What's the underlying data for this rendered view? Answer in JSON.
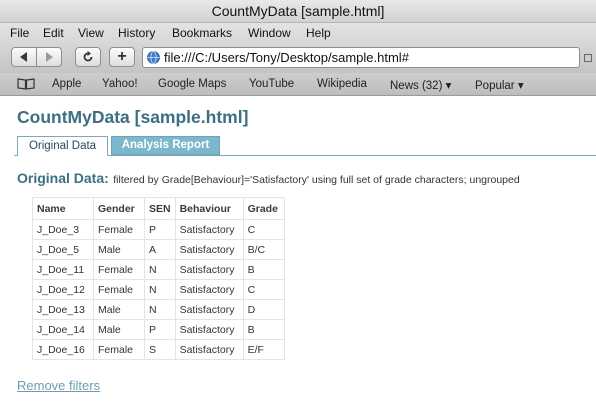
{
  "window": {
    "title": "CountMyData [sample.html]"
  },
  "menu": [
    "File",
    "Edit",
    "View",
    "History",
    "Bookmarks",
    "Window",
    "Help"
  ],
  "address": {
    "url": "file:///C:/Users/Tony/Desktop/sample.html#"
  },
  "toolbar": {
    "add_label": "+"
  },
  "bookmarks": [
    "Apple",
    "Yahoo!",
    "Google Maps",
    "YouTube",
    "Wikipedia",
    "News (32) ▾",
    "Popular ▾"
  ],
  "page": {
    "title": "CountMyData [sample.html]",
    "tabs": [
      "Original Data",
      "Analysis Report"
    ],
    "filter_label": "Original Data:",
    "filter_desc": "filtered by Grade[Behaviour]='Satisfactory' using full set of grade characters; ungrouped",
    "remove_filters": "Remove filters"
  },
  "table": {
    "headers": [
      "Name",
      "Gender",
      "SEN",
      "Behaviour",
      "Grade"
    ],
    "rows": [
      [
        "J_Doe_3",
        "Female",
        "P",
        "Satisfactory",
        "C"
      ],
      [
        "J_Doe_5",
        "Male",
        "A",
        "Satisfactory",
        "B/C"
      ],
      [
        "J_Doe_11",
        "Female",
        "N",
        "Satisfactory",
        "B"
      ],
      [
        "J_Doe_12",
        "Female",
        "N",
        "Satisfactory",
        "C"
      ],
      [
        "J_Doe_13",
        "Male",
        "N",
        "Satisfactory",
        "D"
      ],
      [
        "J_Doe_14",
        "Male",
        "P",
        "Satisfactory",
        "B"
      ],
      [
        "J_Doe_16",
        "Female",
        "S",
        "Satisfactory",
        "E/F"
      ]
    ]
  }
}
